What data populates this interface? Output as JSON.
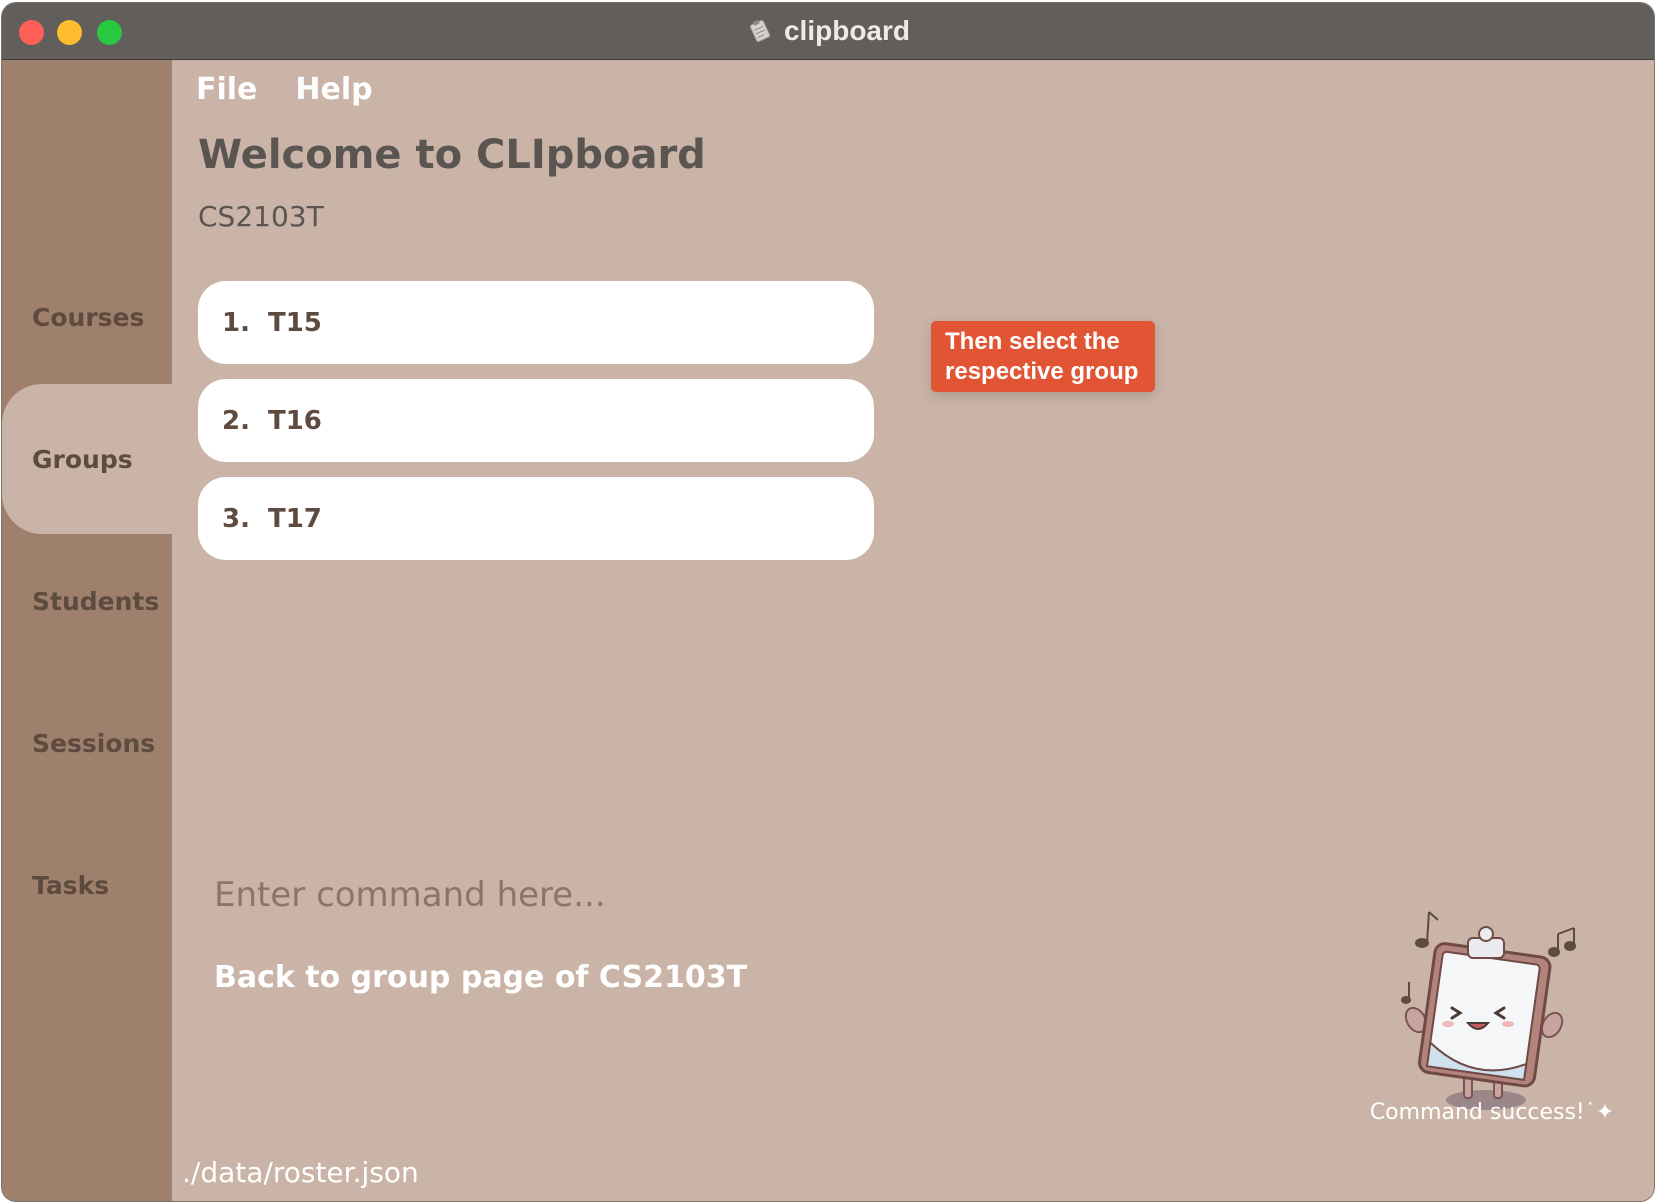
{
  "window": {
    "title": "clipboard",
    "icon": "clipboard-app-icon"
  },
  "sidebar": {
    "items": [
      {
        "label": "Courses",
        "active": false
      },
      {
        "label": "Groups",
        "active": true
      },
      {
        "label": "Students",
        "active": false
      },
      {
        "label": "Sessions",
        "active": false
      },
      {
        "label": "Tasks",
        "active": false
      }
    ]
  },
  "menu": {
    "file": "File",
    "help": "Help"
  },
  "header": {
    "title": "Welcome to CLIpboard",
    "course_code": "CS2103T"
  },
  "groups": [
    {
      "index": "1.",
      "name": "T15"
    },
    {
      "index": "2.",
      "name": "T16"
    },
    {
      "index": "3.",
      "name": "T17"
    }
  ],
  "callout": {
    "text": "Then select the respective group"
  },
  "command": {
    "placeholder": "Enter command here...",
    "value": ""
  },
  "result": {
    "text": "Back to group page of CS2103T"
  },
  "mascot": {
    "caption": "Command success!˙✦"
  },
  "status": {
    "file_path": "./data/roster.json"
  },
  "colors": {
    "sidebar": "#9e806c",
    "main_bg": "#cab4a7",
    "titlebar": "#625e5c",
    "callout": "#e25534",
    "text_dark": "#5e4a3e"
  }
}
